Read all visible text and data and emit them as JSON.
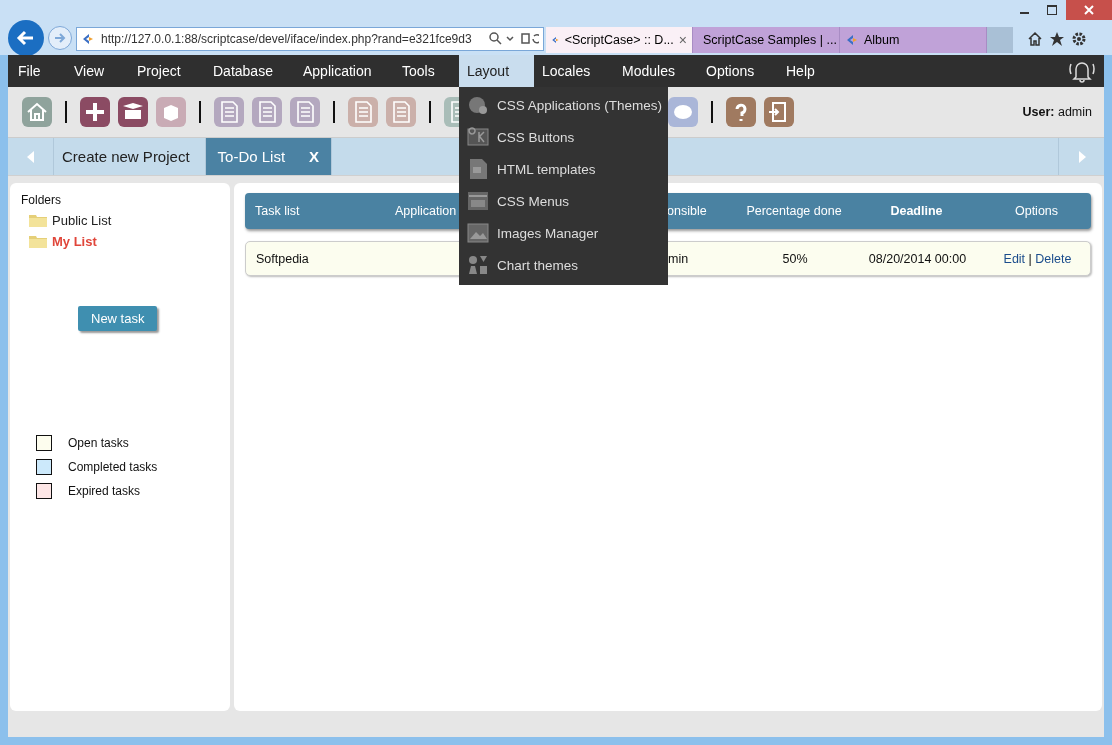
{
  "browser": {
    "url": "http://127.0.0.1:88/scriptcase/devel/iface/index.php?rand=e321fce9d3",
    "tabs": [
      {
        "title": "<ScriptCase> :: D...",
        "selected": true,
        "close": "×"
      },
      {
        "title": "ScriptCase Samples | ...",
        "selected": false
      },
      {
        "title": "Album",
        "selected": false
      }
    ]
  },
  "menu": [
    {
      "label": "File",
      "selected": false
    },
    {
      "label": "View",
      "selected": false
    },
    {
      "label": "Project",
      "selected": false
    },
    {
      "label": "Database",
      "selected": false
    },
    {
      "label": "Application",
      "selected": false
    },
    {
      "label": "Tools",
      "selected": false
    },
    {
      "label": "Layout",
      "selected": true
    },
    {
      "label": "Locales",
      "selected": false
    },
    {
      "label": "Modules",
      "selected": false
    },
    {
      "label": "Options",
      "selected": false
    },
    {
      "label": "Help",
      "selected": false
    }
  ],
  "dropdown": [
    {
      "label": "CSS Applications (Themes)"
    },
    {
      "label": "CSS Buttons"
    },
    {
      "label": "HTML templates"
    },
    {
      "label": "CSS Menus"
    },
    {
      "label": "Images Manager"
    },
    {
      "label": "Chart themes"
    }
  ],
  "user": {
    "label": "User:",
    "name": "admin"
  },
  "project_tabs": [
    {
      "label": "Create new Project",
      "selected": false
    },
    {
      "label": "To-Do List",
      "selected": true,
      "close": "X"
    }
  ],
  "folders": {
    "title": "Folders",
    "items": [
      {
        "label": "Public List",
        "selected": false
      },
      {
        "label": "My List",
        "selected": true
      }
    ]
  },
  "new_task": "New task",
  "legend": [
    {
      "label": "Open tasks",
      "color": "#fdfdee"
    },
    {
      "label": "Completed tasks",
      "color": "#cce9fb"
    },
    {
      "label": "Expired tasks",
      "color": "#fde6e6"
    }
  ],
  "table": {
    "columns": [
      {
        "label": "Task list",
        "sorted": false
      },
      {
        "label": "Application",
        "sorted": false
      },
      {
        "label": "onsible",
        "sorted": false
      },
      {
        "label": "Percentage done",
        "sorted": false
      },
      {
        "label": "Deadline",
        "sorted": true
      },
      {
        "label": "Options",
        "sorted": false
      }
    ],
    "rows": [
      {
        "task_list": "Softpedia",
        "column_3": "min",
        "percentage_done": "50%",
        "deadline": "08/20/2014 00:00",
        "edit": "Edit",
        "separator": "|",
        "delete": "Delete"
      }
    ]
  }
}
